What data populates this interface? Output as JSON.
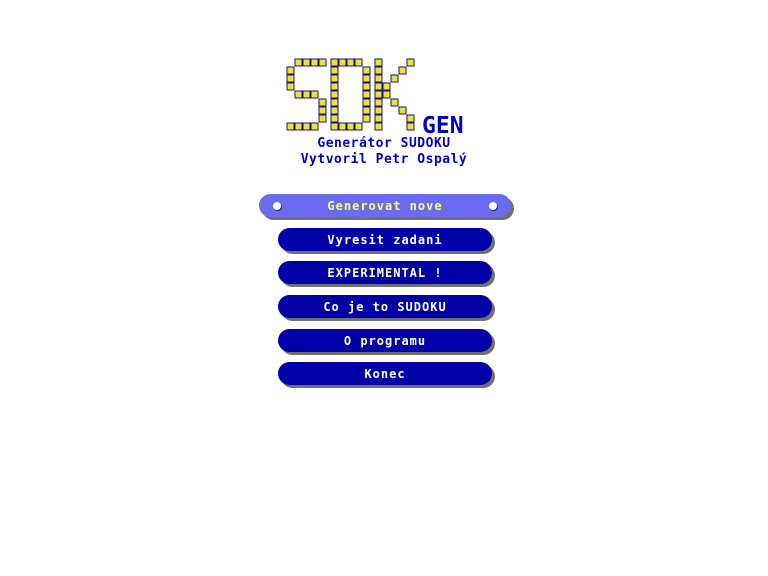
{
  "logo": {
    "letters": "SDK",
    "suffix": "GEN",
    "cell_color": "#f0e030",
    "grid_color": "#1010a0"
  },
  "subtitle": "Generátor SUDOKU",
  "author": "Vytvoril Petr Ospalý",
  "menu": [
    {
      "label": "Generovat nove",
      "selected": true
    },
    {
      "label": "Vyresit zadani",
      "selected": false
    },
    {
      "label": "EXPERIMENTAL !",
      "selected": false
    },
    {
      "label": "Co je to SUDOKU",
      "selected": false
    },
    {
      "label": "O programu",
      "selected": false
    },
    {
      "label": "Konec",
      "selected": false
    }
  ],
  "colors": {
    "button": "#0000a8",
    "button_selected": "#6b6bf0",
    "selected_text": "#ffff66",
    "text": "#0000cc"
  }
}
